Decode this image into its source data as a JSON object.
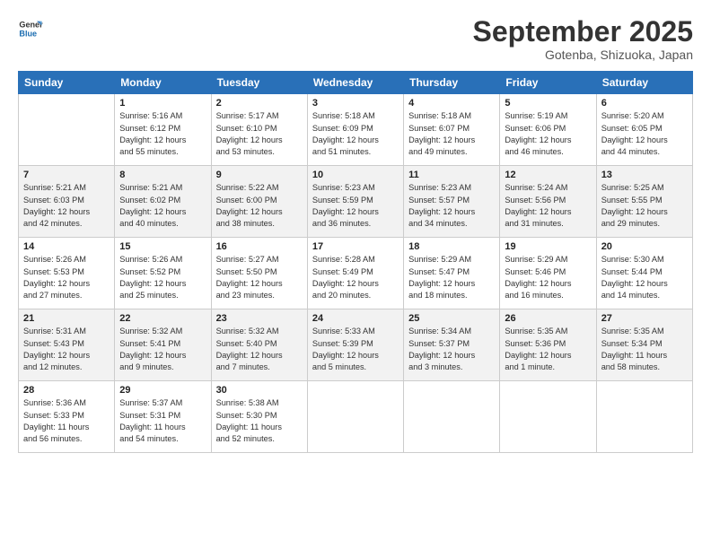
{
  "logo": {
    "line1": "General",
    "line2": "Blue"
  },
  "title": "September 2025",
  "subtitle": "Gotenba, Shizuoka, Japan",
  "weekdays": [
    "Sunday",
    "Monday",
    "Tuesday",
    "Wednesday",
    "Thursday",
    "Friday",
    "Saturday"
  ],
  "weeks": [
    [
      {
        "day": "",
        "info": ""
      },
      {
        "day": "1",
        "info": "Sunrise: 5:16 AM\nSunset: 6:12 PM\nDaylight: 12 hours\nand 55 minutes."
      },
      {
        "day": "2",
        "info": "Sunrise: 5:17 AM\nSunset: 6:10 PM\nDaylight: 12 hours\nand 53 minutes."
      },
      {
        "day": "3",
        "info": "Sunrise: 5:18 AM\nSunset: 6:09 PM\nDaylight: 12 hours\nand 51 minutes."
      },
      {
        "day": "4",
        "info": "Sunrise: 5:18 AM\nSunset: 6:07 PM\nDaylight: 12 hours\nand 49 minutes."
      },
      {
        "day": "5",
        "info": "Sunrise: 5:19 AM\nSunset: 6:06 PM\nDaylight: 12 hours\nand 46 minutes."
      },
      {
        "day": "6",
        "info": "Sunrise: 5:20 AM\nSunset: 6:05 PM\nDaylight: 12 hours\nand 44 minutes."
      }
    ],
    [
      {
        "day": "7",
        "info": "Sunrise: 5:21 AM\nSunset: 6:03 PM\nDaylight: 12 hours\nand 42 minutes."
      },
      {
        "day": "8",
        "info": "Sunrise: 5:21 AM\nSunset: 6:02 PM\nDaylight: 12 hours\nand 40 minutes."
      },
      {
        "day": "9",
        "info": "Sunrise: 5:22 AM\nSunset: 6:00 PM\nDaylight: 12 hours\nand 38 minutes."
      },
      {
        "day": "10",
        "info": "Sunrise: 5:23 AM\nSunset: 5:59 PM\nDaylight: 12 hours\nand 36 minutes."
      },
      {
        "day": "11",
        "info": "Sunrise: 5:23 AM\nSunset: 5:57 PM\nDaylight: 12 hours\nand 34 minutes."
      },
      {
        "day": "12",
        "info": "Sunrise: 5:24 AM\nSunset: 5:56 PM\nDaylight: 12 hours\nand 31 minutes."
      },
      {
        "day": "13",
        "info": "Sunrise: 5:25 AM\nSunset: 5:55 PM\nDaylight: 12 hours\nand 29 minutes."
      }
    ],
    [
      {
        "day": "14",
        "info": "Sunrise: 5:26 AM\nSunset: 5:53 PM\nDaylight: 12 hours\nand 27 minutes."
      },
      {
        "day": "15",
        "info": "Sunrise: 5:26 AM\nSunset: 5:52 PM\nDaylight: 12 hours\nand 25 minutes."
      },
      {
        "day": "16",
        "info": "Sunrise: 5:27 AM\nSunset: 5:50 PM\nDaylight: 12 hours\nand 23 minutes."
      },
      {
        "day": "17",
        "info": "Sunrise: 5:28 AM\nSunset: 5:49 PM\nDaylight: 12 hours\nand 20 minutes."
      },
      {
        "day": "18",
        "info": "Sunrise: 5:29 AM\nSunset: 5:47 PM\nDaylight: 12 hours\nand 18 minutes."
      },
      {
        "day": "19",
        "info": "Sunrise: 5:29 AM\nSunset: 5:46 PM\nDaylight: 12 hours\nand 16 minutes."
      },
      {
        "day": "20",
        "info": "Sunrise: 5:30 AM\nSunset: 5:44 PM\nDaylight: 12 hours\nand 14 minutes."
      }
    ],
    [
      {
        "day": "21",
        "info": "Sunrise: 5:31 AM\nSunset: 5:43 PM\nDaylight: 12 hours\nand 12 minutes."
      },
      {
        "day": "22",
        "info": "Sunrise: 5:32 AM\nSunset: 5:41 PM\nDaylight: 12 hours\nand 9 minutes."
      },
      {
        "day": "23",
        "info": "Sunrise: 5:32 AM\nSunset: 5:40 PM\nDaylight: 12 hours\nand 7 minutes."
      },
      {
        "day": "24",
        "info": "Sunrise: 5:33 AM\nSunset: 5:39 PM\nDaylight: 12 hours\nand 5 minutes."
      },
      {
        "day": "25",
        "info": "Sunrise: 5:34 AM\nSunset: 5:37 PM\nDaylight: 12 hours\nand 3 minutes."
      },
      {
        "day": "26",
        "info": "Sunrise: 5:35 AM\nSunset: 5:36 PM\nDaylight: 12 hours\nand 1 minute."
      },
      {
        "day": "27",
        "info": "Sunrise: 5:35 AM\nSunset: 5:34 PM\nDaylight: 11 hours\nand 58 minutes."
      }
    ],
    [
      {
        "day": "28",
        "info": "Sunrise: 5:36 AM\nSunset: 5:33 PM\nDaylight: 11 hours\nand 56 minutes."
      },
      {
        "day": "29",
        "info": "Sunrise: 5:37 AM\nSunset: 5:31 PM\nDaylight: 11 hours\nand 54 minutes."
      },
      {
        "day": "30",
        "info": "Sunrise: 5:38 AM\nSunset: 5:30 PM\nDaylight: 11 hours\nand 52 minutes."
      },
      {
        "day": "",
        "info": ""
      },
      {
        "day": "",
        "info": ""
      },
      {
        "day": "",
        "info": ""
      },
      {
        "day": "",
        "info": ""
      }
    ]
  ]
}
